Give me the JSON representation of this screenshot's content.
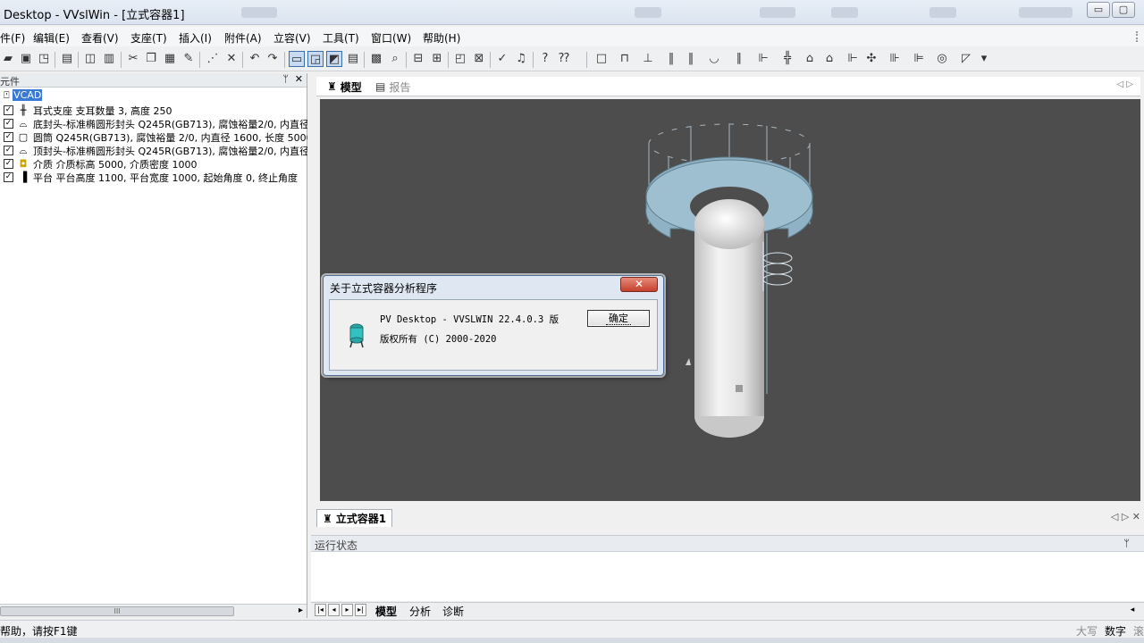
{
  "window": {
    "title": "Desktop - VVslWin - [立式容器1]",
    "min_label": "▭",
    "max_label": "▢"
  },
  "menu": [
    "件(F)",
    "编辑(E)",
    "查看(V)",
    "支座(T)",
    "插入(I)",
    "附件(A)",
    "立容(V)",
    "工具(T)",
    "窗口(W)",
    "帮助(H)"
  ],
  "left_panel": {
    "header": "元件",
    "pin": "ᛘ",
    "close": "✕",
    "root_label": "VCAD",
    "items": [
      {
        "icon": "ear-support-icon",
        "glyph": "╫",
        "text": "耳式支座 支耳数量 3, 高度 250"
      },
      {
        "icon": "bottom-head-icon",
        "glyph": "⌓",
        "text": "底封头-标准椭圆形封头 Q245R(GB713), 腐蚀裕量2/0, 内直径"
      },
      {
        "icon": "cylinder-icon",
        "glyph": "▢",
        "text": "圆筒 Q245R(GB713), 腐蚀裕量 2/0, 内直径 1600, 长度 5000"
      },
      {
        "icon": "top-head-icon",
        "glyph": "⌓",
        "text": "顶封头-标准椭圆形封头 Q245R(GB713), 腐蚀裕量2/0, 内直径"
      },
      {
        "icon": "medium-icon",
        "glyph": "◘",
        "text": "介质 介质标高 5000, 介质密度 1000"
      },
      {
        "icon": "platform-icon",
        "glyph": "▐",
        "text": "平台 平台高度 1100, 平台宽度 1000, 起始角度 0, 终止角度"
      }
    ],
    "hscroll_grip": "III",
    "hscroll_arrow": "▸"
  },
  "view_tabs": [
    {
      "label": "模型",
      "active": true
    },
    {
      "label": "报告",
      "active": false
    }
  ],
  "view_nav": "◁ ▷",
  "doc_tab": "立式容器1",
  "doc_nav": "◁ ▷ ✕",
  "run_status": {
    "title": "运行状态",
    "pin": "ᛘ"
  },
  "sheet_tabs": [
    {
      "label": "模型",
      "active": true
    },
    {
      "label": "分析",
      "active": false
    },
    {
      "label": "诊断",
      "active": false
    }
  ],
  "sheet_nav": [
    "|◂",
    "◂",
    "▸",
    "▸|"
  ],
  "sheet_scroll": "◂",
  "status_bar": {
    "help": "帮助，请按F1键",
    "caps": "大写",
    "num": "数字",
    "scrl": "滚"
  },
  "dialog": {
    "title": "关于立式容器分析程序",
    "close_label": "✕",
    "line1": "PV Desktop - VVSLWIN 22.4.0.3 版",
    "line2": "版权所有 (C) 2000-2020",
    "ok_label": "确定"
  }
}
